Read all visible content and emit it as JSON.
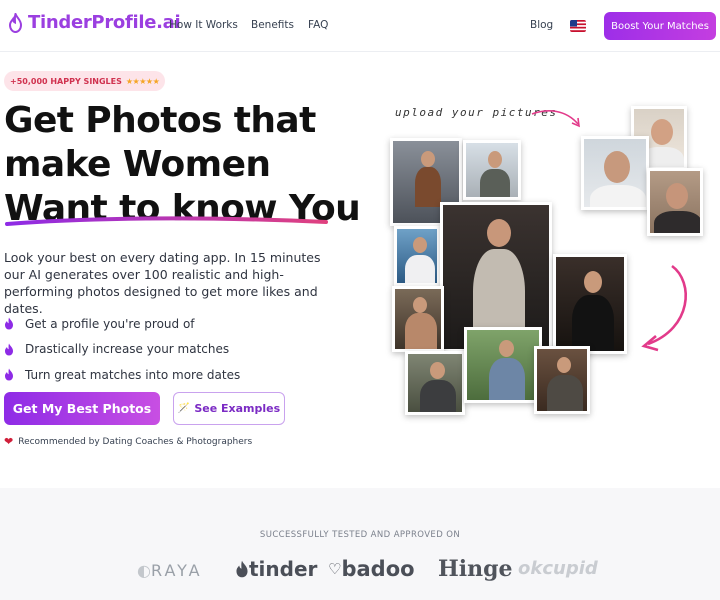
{
  "nav": {
    "logo_text": "TinderProfile.ai",
    "links": [
      "How It Works",
      "Benefits",
      "FAQ"
    ],
    "blog": "Blog",
    "flag_icon": "us-flag-icon",
    "cta": "Boost Your Matches"
  },
  "hero": {
    "badge": "+50,000 HAPPY SINGLES",
    "badge_stars": "★★★★★",
    "headline": [
      "Get Photos that",
      "make Women",
      "Want to know You"
    ],
    "description": "Look your best on every dating app. In 15 minutes our AI generates over 100 realistic and high-performing photos designed to get more likes and dates.",
    "bullets": [
      "Get a profile you're proud of",
      "Drastically increase your matches",
      "Turn great matches into more dates"
    ],
    "cta_primary": "Get My Best Photos",
    "cta_secondary": "See Examples",
    "recommend": "Recommended by Dating Coaches & Photographers"
  },
  "collage": {
    "upload_label": "upload your pictures"
  },
  "colors": {
    "accent": "#9b3fe0",
    "badge_text": "#d0324f",
    "arrow": "#e23a8a"
  },
  "trust": {
    "label": "SUCCESSFULLY TESTED AND APPROVED ON",
    "brands": [
      "RAYA",
      "tinder",
      "badoo",
      "Hinge",
      "okcupid"
    ]
  }
}
